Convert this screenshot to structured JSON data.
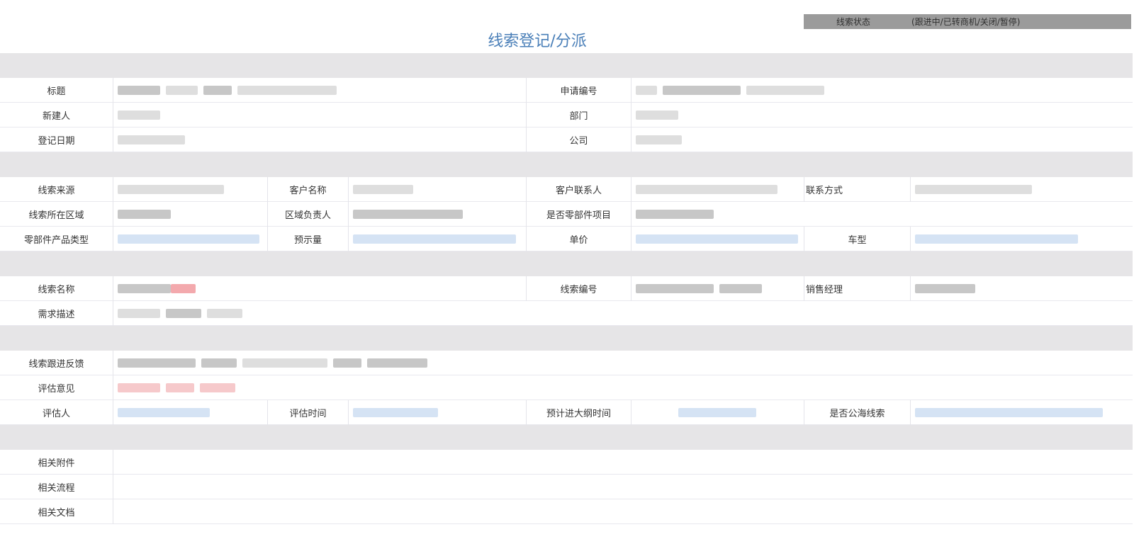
{
  "header": {
    "status_label": "线索状态",
    "status_value": "(跟进中/已转商机/关闭/暂停)",
    "title": "线索登记/分派"
  },
  "basic": {
    "title_label": "标题",
    "apply_no_label": "申请编号",
    "creator_label": "新建人",
    "department_label": "部门",
    "register_date_label": "登记日期",
    "company_label": "公司"
  },
  "lead_source": {
    "source_label": "线索来源",
    "customer_name_label": "客户名称",
    "customer_contact_label": "客户联系人",
    "contact_method_label": "联系方式",
    "region_label": "线索所在区域",
    "region_owner_label": "区域负责人",
    "parts_project_label": "是否零部件项目",
    "parts_type_label": "零部件产品类型",
    "forecast_qty_label": "预示量",
    "unit_price_label": "单价",
    "vehicle_model_label": "车型"
  },
  "lead_info": {
    "lead_name_label": "线索名称",
    "lead_no_label": "线索编号",
    "sales_manager_label": "销售经理",
    "requirement_label": "需求描述"
  },
  "evaluation": {
    "feedback_label": "线索跟进反馈",
    "opinion_label": "评估意见",
    "evaluator_label": "评估人",
    "eval_time_label": "评估时间",
    "outline_time_label": "预计进大纲时间",
    "public_pool_label": "是否公海线索"
  },
  "related": {
    "attachments_label": "相关附件",
    "processes_label": "相关流程",
    "documents_label": "相关文档"
  },
  "colors": {
    "title": "#4a7fb8",
    "section_band": "#e6e5e7",
    "status_bar": "#9b9b9b"
  }
}
